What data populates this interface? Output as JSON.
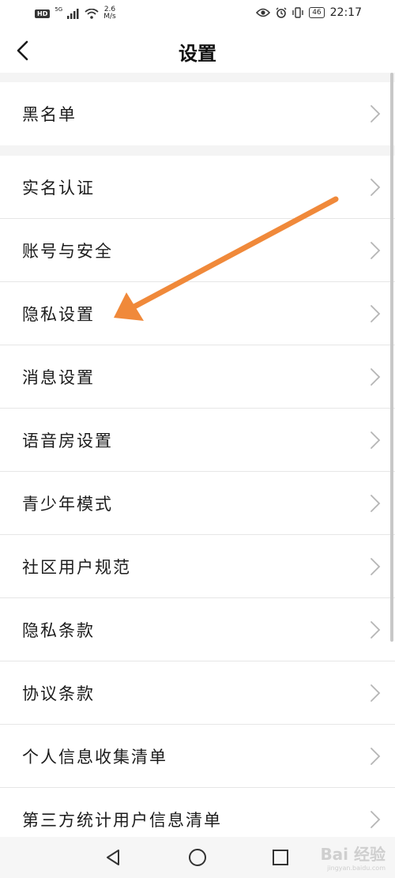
{
  "status_bar": {
    "hd": "HD",
    "network": "5G",
    "speed_value": "2.6",
    "speed_unit": "M/s",
    "battery": "46",
    "time": "22:17"
  },
  "header": {
    "title": "设置"
  },
  "menu": {
    "group1": [
      {
        "label": "黑名单"
      }
    ],
    "group2": [
      {
        "label": "实名认证"
      },
      {
        "label": "账号与安全"
      },
      {
        "label": "隐私设置"
      },
      {
        "label": "消息设置"
      },
      {
        "label": "语音房设置"
      },
      {
        "label": "青少年模式"
      },
      {
        "label": "社区用户规范"
      },
      {
        "label": "隐私条款"
      },
      {
        "label": "协议条款"
      },
      {
        "label": "个人信息收集清单"
      },
      {
        "label": "第三方统计用户信息清单"
      }
    ]
  },
  "annotation": {
    "arrow_color": "#F0893A"
  },
  "watermark": {
    "text": "Bai 经验",
    "url": "jingyan.baidu.com"
  },
  "colors": {
    "background": "#f4f4f4",
    "surface": "#ffffff",
    "chevron": "#b5b5b5"
  }
}
